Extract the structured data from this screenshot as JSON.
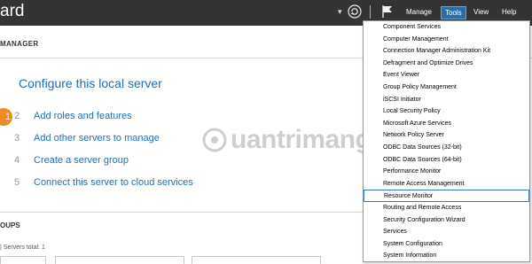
{
  "window": {
    "title": "ard"
  },
  "menubar": {
    "manage": "Manage",
    "tools": "Tools",
    "view": "View",
    "help": "Help"
  },
  "header": {
    "section": "MANAGER"
  },
  "quickstart": {
    "step1": {
      "num": "1",
      "label": "Configure this local server"
    },
    "steps": [
      {
        "num": "2",
        "label": "Add roles and features"
      },
      {
        "num": "3",
        "label": "Add other servers to manage"
      },
      {
        "num": "4",
        "label": "Create a server group"
      },
      {
        "num": "5",
        "label": "Connect this server to cloud services"
      }
    ]
  },
  "groups": {
    "title": "OUPS",
    "count": "| Servers total: 1"
  },
  "watermark": {
    "text": "uantrimang"
  },
  "tools_menu": {
    "items": [
      "Component Services",
      "Computer Management",
      "Connection Manager Administration Kit",
      "Defragment and Optimize Drives",
      "Event Viewer",
      "Group Policy Management",
      "iSCSI Initiator",
      "Local Security Policy",
      "Microsoft Azure Services",
      "Network Policy Server",
      "ODBC Data Sources (32-bit)",
      "ODBC Data Sources (64-bit)",
      "Performance Monitor",
      "Remote Access Management",
      "Resource Monitor",
      "Routing and Remote Access",
      "Security Configuration Wizard",
      "Services",
      "System Configuration",
      "System Information"
    ],
    "highlighted": "Resource Monitor"
  },
  "colors": {
    "accent_blue": "#1f6fb5",
    "step_orange": "#f08a24",
    "topbar": "#343434"
  },
  "icons": [
    "refresh-icon",
    "flag-icon",
    "caret-icon"
  ]
}
